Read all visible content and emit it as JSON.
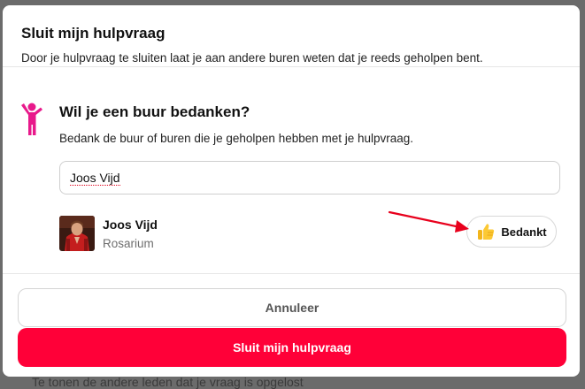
{
  "modal": {
    "title": "Sluit mijn hulpvraag",
    "subtitle": "Door je hulpvraag te sluiten laat je aan andere buren weten dat je reeds geholpen bent."
  },
  "thank_section": {
    "icon": "person-raising-hand-icon",
    "title": "Wil je een buur bedanken?",
    "description": "Bedank de buur of buren die je geholpen hebben met je hulpvraag.",
    "search_value": "Joos Vijd"
  },
  "result": {
    "name": "Joos Vijd",
    "subtitle": "Rosarium",
    "thank_button": {
      "icon": "thumbs-up-icon",
      "label": "Bedankt"
    }
  },
  "footer": {
    "cancel_label": "Annuleer",
    "confirm_label": "Sluit mijn hulpvraag"
  },
  "background": {
    "partial_text": "Te tonen de andere leden dat je vraag is opgelost"
  },
  "colors": {
    "accent": "#ff0038",
    "icon_magenta": "#e8198b",
    "annotation_arrow": "#e8001c"
  }
}
